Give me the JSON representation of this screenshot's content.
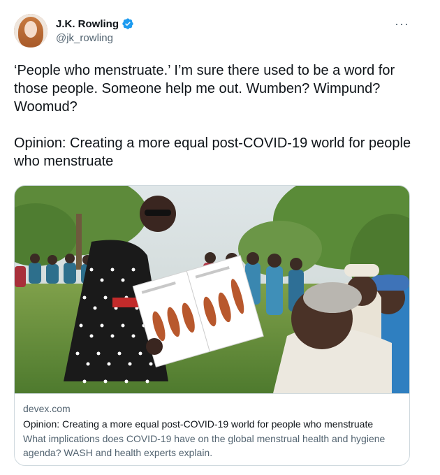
{
  "author": {
    "display_name": "J.K. Rowling",
    "handle": "@jk_rowling",
    "verified": true,
    "avatar_icon": "avatar-photo"
  },
  "menu": {
    "more_label": "···"
  },
  "tweet": {
    "text": "‘People who menstruate.’ I’m sure there used to be a word for those people. Someone help me out. Wumben? Wimpund? Woomud?\n\nOpinion: Creating a more equal post-COVID-19 world for people who menstruate"
  },
  "link_card": {
    "domain": "devex.com",
    "title": "Opinion: Creating a more equal post-COVID-19 world for people who menstruate",
    "description": "What implications does COVID-19 have on the global menstrual health and hygiene agenda? WASH and health experts explain."
  },
  "colors": {
    "verified_blue": "#1d9bf0",
    "secondary_text": "#536471",
    "primary_text": "#0f1419",
    "border": "#cfd9de"
  }
}
